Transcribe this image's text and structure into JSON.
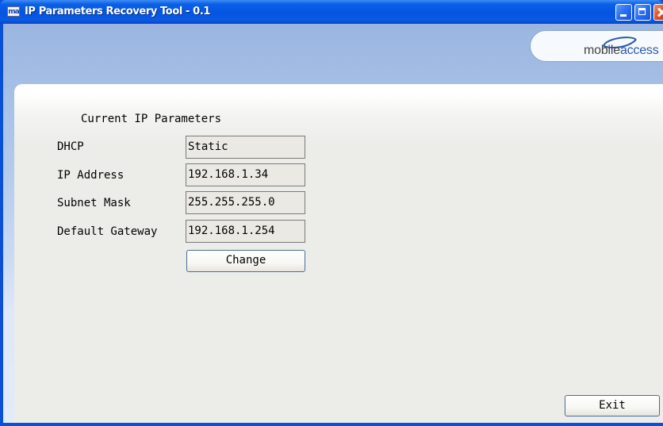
{
  "window": {
    "title": "IP Parameters Recovery Tool - 0.1",
    "app_icon_text": "ma",
    "title_color": "#0a5fe8"
  },
  "logo": {
    "text_main": "mobile",
    "text_accent": "access"
  },
  "form": {
    "section_title": "Current IP Parameters",
    "fields": [
      {
        "label": "DHCP",
        "value": "Static"
      },
      {
        "label": "IP Address",
        "value": "192.168.1.34"
      },
      {
        "label": "Subnet Mask",
        "value": "255.255.255.0"
      },
      {
        "label": "Default Gateway",
        "value": "192.168.1.254"
      }
    ],
    "change_label": "Change"
  },
  "footer": {
    "exit_label": "Exit"
  }
}
